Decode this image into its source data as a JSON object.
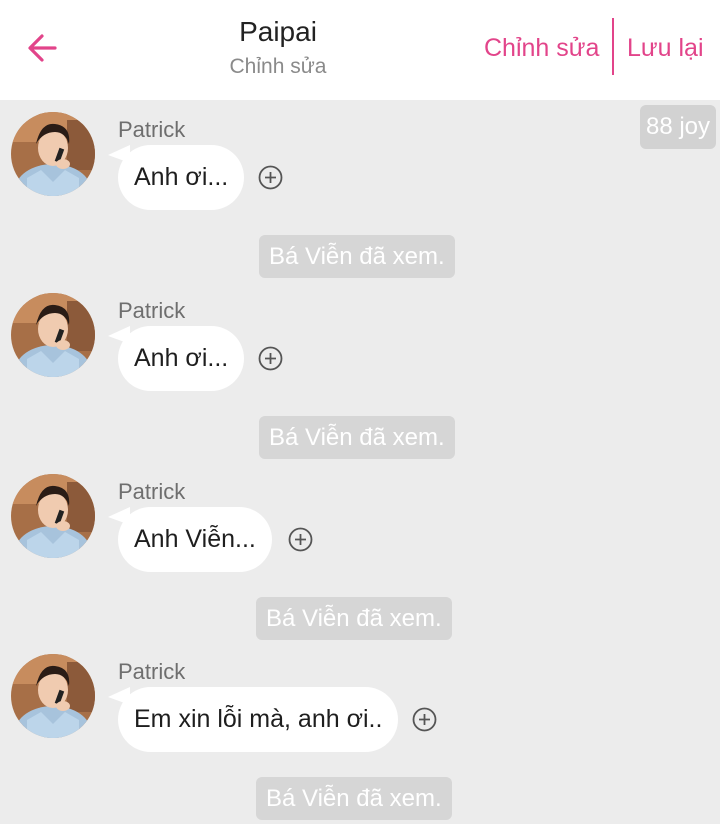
{
  "header": {
    "title": "Paipai",
    "subtitle": "Chỉnh sửa",
    "edit_label": "Chỉnh sửa",
    "save_label": "Lưu lại",
    "accent_color": "#e2448a"
  },
  "joy_badge": "88 joy",
  "messages": [
    {
      "sender": "Patrick",
      "text": "Anh ơi...",
      "seen": "Bá Viễn đã xem."
    },
    {
      "sender": "Patrick",
      "text": "Anh ơi...",
      "seen": "Bá Viễn đã xem."
    },
    {
      "sender": "Patrick",
      "text": "Anh Viễn...",
      "seen": "Bá Viễn đã xem."
    },
    {
      "sender": "Patrick",
      "text": "Em xin lỗi mà, anh ơi..",
      "seen": "Bá Viễn đã xem."
    }
  ],
  "icons": {
    "back": "arrow-left-icon",
    "add": "plus-circle-icon",
    "avatar": "avatar-photo"
  }
}
